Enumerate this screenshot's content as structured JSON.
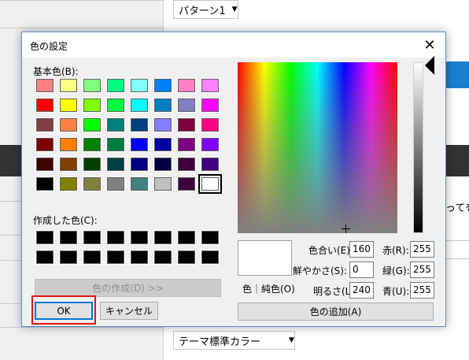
{
  "background": {
    "dropdown_top": {
      "value": "パターン1"
    },
    "dropdown_bottom": {
      "value": "テーマ標準カラー"
    },
    "side_text": "ってを空"
  },
  "dialog": {
    "title": "色の設定",
    "basic_colors_label": "基本色(B):",
    "basic_colors": [
      [
        "#ff8080",
        "#ffff80",
        "#80ff80",
        "#00ff80",
        "#80ffff",
        "#0080ff",
        "#ff80c0",
        "#ff80ff"
      ],
      [
        "#ff0000",
        "#ffff00",
        "#80ff00",
        "#00ff40",
        "#00ffff",
        "#0080c0",
        "#8080c0",
        "#ff00ff"
      ],
      [
        "#804040",
        "#ff8040",
        "#00ff00",
        "#008080",
        "#004080",
        "#8080ff",
        "#800040",
        "#ff0080"
      ],
      [
        "#800000",
        "#ff8000",
        "#008000",
        "#008040",
        "#0000ff",
        "#0000a0",
        "#800080",
        "#8000ff"
      ],
      [
        "#400000",
        "#804000",
        "#004000",
        "#004040",
        "#000080",
        "#000040",
        "#400040",
        "#400080"
      ],
      [
        "#000000",
        "#808000",
        "#808040",
        "#808080",
        "#408080",
        "#c0c0c0",
        "#400040",
        "#ffffff"
      ]
    ],
    "custom_colors_label": "作成した色(C):",
    "define_custom_button": "色の作成(D) >>",
    "ok_button": "OK",
    "cancel_button": "キャンセル",
    "color_solid_label": "色｜純色(O)",
    "hue_label": "色合い(E):",
    "hue_value": "160",
    "sat_label": "鮮やかさ(S):",
    "sat_value": "0",
    "lum_label": "明るさ(L):",
    "lum_value": "240",
    "red_label": "赤(R):",
    "red_value": "255",
    "green_label": "緑(G):",
    "green_value": "255",
    "blue_label": "青(U):",
    "blue_value": "255",
    "add_custom_button": "色の追加(A)"
  }
}
